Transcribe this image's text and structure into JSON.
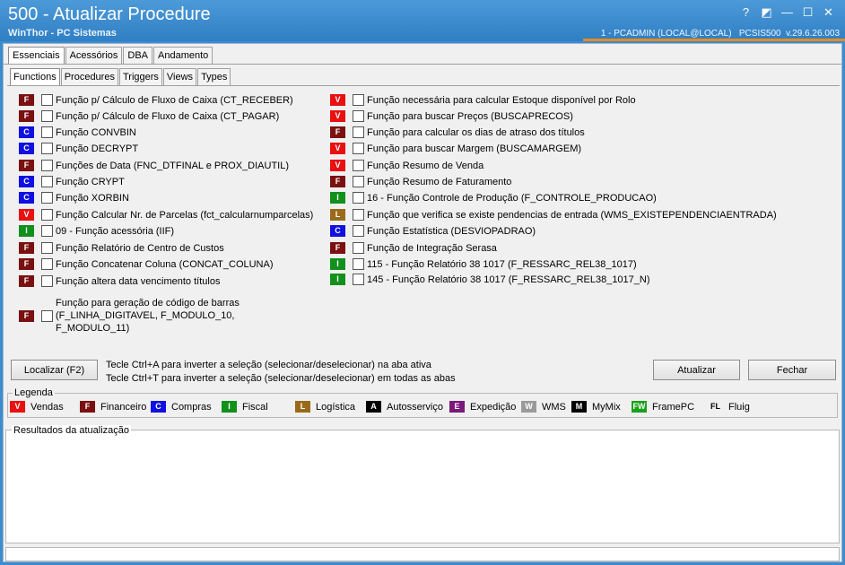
{
  "window": {
    "title": "500 - Atualizar Procedure",
    "subtitle": "WinThor - PC Sistemas",
    "userinfo": "1 - PCADMIN (LOCAL@LOCAL)   PCSIS500  v.29.6.26.003",
    "controls": [
      "?",
      "◩",
      "—",
      "☐",
      "✕"
    ]
  },
  "tabs_main": [
    "Essenciais",
    "Acessórios",
    "DBA",
    "Andamento"
  ],
  "tabs_sub": [
    "Functions",
    "Procedures",
    "Triggers",
    "Views",
    "Types"
  ],
  "items_left": [
    {
      "code": "F",
      "label": "Função p/ Cálculo de Fluxo de Caixa (CT_RECEBER)"
    },
    {
      "code": "F",
      "label": "Função p/ Cálculo de Fluxo de Caixa (CT_PAGAR)"
    },
    {
      "code": "C",
      "label": "Função CONVBIN"
    },
    {
      "code": "C",
      "label": "Função DECRYPT"
    },
    {
      "code": "F",
      "label": "Funções de Data (FNC_DTFINAL e PROX_DIAUTIL)"
    },
    {
      "code": "C",
      "label": "Função CRYPT"
    },
    {
      "code": "C",
      "label": "Função XORBIN"
    },
    {
      "code": "V",
      "label": "Função Calcular Nr. de Parcelas (fct_calcularnumparcelas)"
    },
    {
      "code": "I",
      "label": "09 - Função acessória (IIF)"
    },
    {
      "code": "F",
      "label": "Função Relatório de Centro de Custos"
    },
    {
      "code": "F",
      "label": "Função Concatenar Coluna (CONCAT_COLUNA)"
    },
    {
      "code": "F",
      "label": "Função altera data vencimento títulos"
    },
    {
      "code": "F",
      "label": "Função para geração de código de barras\n(F_LINHA_DIGITAVEL, F_MODULO_10,\nF_MODULO_11)"
    }
  ],
  "items_right": [
    {
      "code": "V",
      "label": "Função necessária para calcular Estoque disponível por Rolo"
    },
    {
      "code": "V",
      "label": "Função para buscar Preços (BUSCAPRECOS)"
    },
    {
      "code": "F",
      "label": "Função para calcular os dias de atraso dos títulos"
    },
    {
      "code": "V",
      "label": "Função para buscar Margem (BUSCAMARGEM)"
    },
    {
      "code": "V",
      "label": "Função Resumo de Venda"
    },
    {
      "code": "F",
      "label": "Função Resumo de Faturamento"
    },
    {
      "code": "I",
      "label": "16 - Função Controle de Produção (F_CONTROLE_PRODUCAO)"
    },
    {
      "code": "L",
      "label": "Função que verifica se existe pendencias de entrada (WMS_EXISTEPENDENCIAENTRADA)"
    },
    {
      "code": "C",
      "label": "Função Estatística (DESVIOPADRAO)"
    },
    {
      "code": "F",
      "label": "Função de Integração Serasa"
    },
    {
      "code": "I",
      "label": "115 - Função Relatório 38 1017 (F_RESSARC_REL38_1017)"
    },
    {
      "code": "I",
      "label": "145 - Função Relatório 38 1017 (F_RESSARC_REL38_1017_N)"
    }
  ],
  "buttons": {
    "localizar": "Localizar (F2)",
    "atualizar": "Atualizar",
    "fechar": "Fechar"
  },
  "hints": [
    "Tecle Ctrl+A para inverter a seleção (selecionar/deselecionar) na aba ativa",
    "Tecle Ctrl+T para inverter a seleção (selecionar/deselecionar) em todas as abas"
  ],
  "legend": {
    "title": "Legenda",
    "items": [
      {
        "code": "V",
        "label": "Vendas",
        "color": "#e81010",
        "text": "#ffffff"
      },
      {
        "code": "F",
        "label": "Financeiro",
        "color": "#7a1010",
        "text": "#ffffff"
      },
      {
        "code": "C",
        "label": "Compras",
        "color": "#1010e0",
        "text": "#ffffff"
      },
      {
        "code": "I",
        "label": "Fiscal",
        "color": "#12901c",
        "text": "#ffffff"
      },
      {
        "code": "L",
        "label": "Logística",
        "color": "#9a6a1a",
        "text": "#ffffff"
      },
      {
        "code": "A",
        "label": "Autosserviço",
        "color": "#000000",
        "text": "#ffffff"
      },
      {
        "code": "E",
        "label": "Expedição",
        "color": "#7a1a7a",
        "text": "#ffffff"
      },
      {
        "code": "W",
        "label": "WMS",
        "color": "#9a9a9a",
        "text": "#ffffff"
      },
      {
        "code": "M",
        "label": "MyMix",
        "color": "#000000",
        "text": "#ffffff"
      },
      {
        "code": "FW",
        "label": "FramePC",
        "color": "#1aa01a",
        "text": "#ffffff"
      },
      {
        "code": "FL",
        "label": "Fluig",
        "color": "#f0f0f0",
        "text": "#000000"
      }
    ]
  },
  "results": {
    "title": "Resultados da atualização"
  },
  "colors": {
    "V": "#e81010",
    "F": "#7a1010",
    "C": "#1010e0",
    "I": "#12901c",
    "L": "#9a6a1a",
    "accent_line": "#e88b1a",
    "titlebar": "#3d8ccf"
  }
}
